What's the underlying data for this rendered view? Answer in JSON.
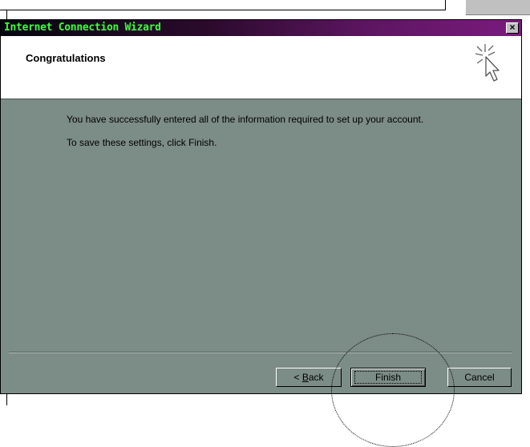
{
  "window": {
    "title": "Internet Connection Wizard",
    "close_glyph": "×"
  },
  "header": {
    "title": "Congratulations",
    "icon": "wizard-cursor-sparkle-icon"
  },
  "body": {
    "line1": "You have successfully entered all of the information required to set up your account.",
    "line2": "To save these settings, click Finish."
  },
  "buttons": {
    "back_prefix": "< ",
    "back_accel": "B",
    "back_rest": "ack",
    "finish": "Finish",
    "cancel": "Cancel"
  },
  "colors": {
    "dialog_bg": "#7c8c87",
    "title_text": "#3cff3c",
    "title_gradient_end": "#7a1b7e"
  }
}
